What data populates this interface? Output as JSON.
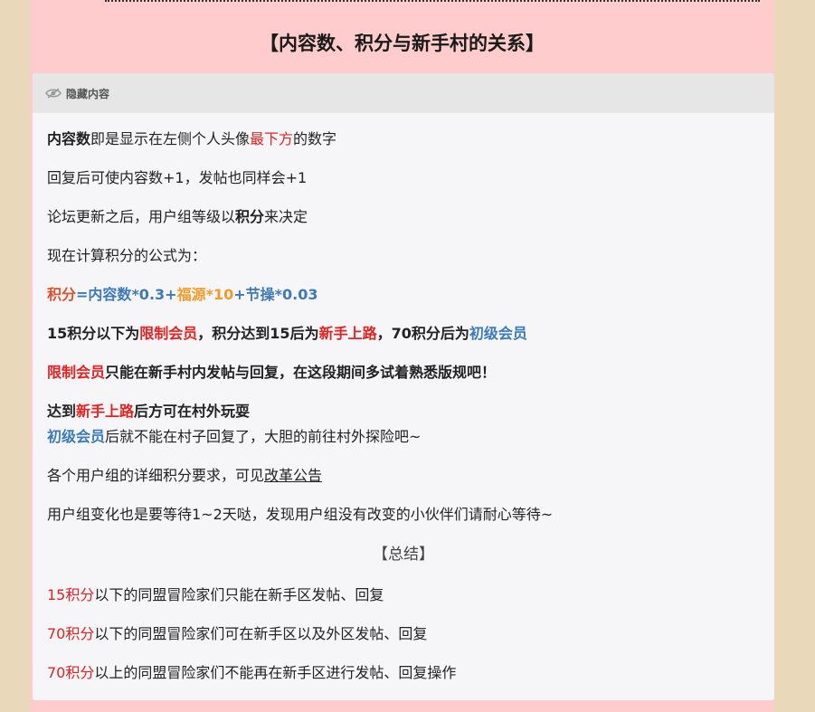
{
  "title": "【内容数、积分与新手村的关系】",
  "hidden": {
    "label": "隐藏内容",
    "icon": "hidden-eye-icon"
  },
  "colors": {
    "background": "#ead8ba",
    "page": "#fecccc",
    "red": "#e32222",
    "blue": "#3d7ab8",
    "orange": "#f19b28"
  },
  "lines": {
    "l1": {
      "a": "内容数",
      "b": "即是显示在左侧个人头像",
      "c": "最下方",
      "d": "的数字"
    },
    "l2": "回复后可使内容数+1，发帖也同样会+1",
    "l3": {
      "a": "论坛更新之后，用户组等级以",
      "b": "积分",
      "c": "来决定"
    },
    "l4": "现在计算积分的公式为：",
    "l5": {
      "a": "积分",
      "b": "=",
      "c": "内容数",
      "d": "*0.3",
      "e": "+",
      "f": "福源",
      "g": "*10",
      "h": "+",
      "i": "节操",
      "j": "*0.03"
    },
    "l6": {
      "a": "15积分以下为",
      "b": "限制会员",
      "c": "，积分达到15后为",
      "d": "新手上路",
      "e": "，70积分后为",
      "f": "初级会员"
    },
    "l7": {
      "a": "限制会员",
      "b": "只能在新手村内发帖与回复，在这段期间多试着熟悉版规吧！"
    },
    "l8": {
      "a": "达到",
      "b": "新手上路",
      "c": "后方可在村外玩耍"
    },
    "l9": {
      "a": "初级会员",
      "b": "后就不能在村子回复了，大胆的前往村外探险吧~"
    },
    "l10": {
      "a": "各个用户组的详细积分要求，可见",
      "b": "改革公告"
    },
    "l11": "用户组变化也是要等待1~2天哒，发现用户组没有改变的小伙伴们请耐心等待~",
    "summary": "【总结】",
    "s1": {
      "a": "15积分",
      "b": "以下的同盟冒险家们只能在新手区发帖、回复"
    },
    "s2": {
      "a": "70积分",
      "b": "以下的同盟冒险家们可在新手区以及外区发帖、回复"
    },
    "s3": {
      "a": "70积分",
      "b": "以上的同盟冒险家们不能再在新手区进行发帖、回复操作"
    }
  }
}
